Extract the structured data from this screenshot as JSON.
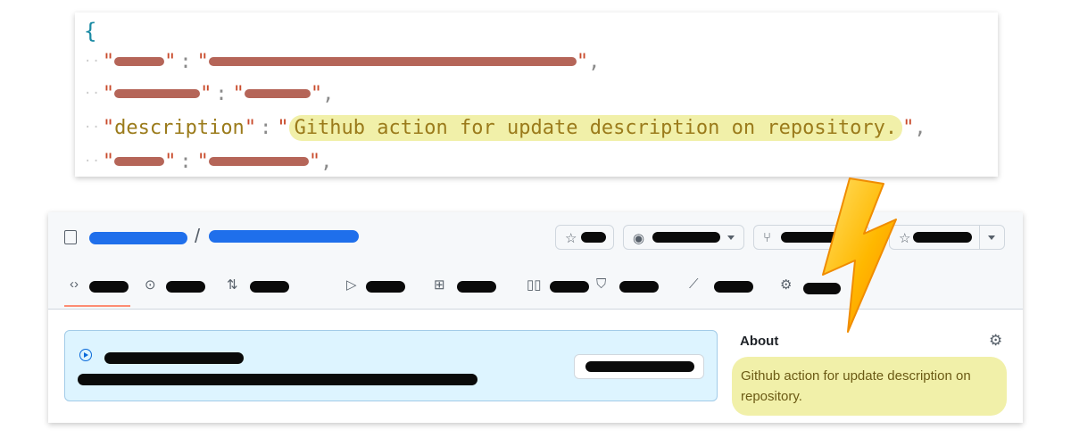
{
  "code_card": {
    "open_brace": "{",
    "dots": "··",
    "quote": "\"",
    "colon": ":",
    "comma": ",",
    "description_key": "description",
    "description_value": "Github action for update description on repository."
  },
  "repo_header": {
    "separator": "/"
  },
  "about": {
    "title": "About",
    "description": "Github action for update description on repository."
  },
  "icons": {
    "repo": "repo-icon",
    "pin": "pin-icon",
    "eye": "eye-icon",
    "fork": "fork-icon",
    "star": "star-icon",
    "code": "code-icon",
    "issues": "issues-icon",
    "pull_requests": "pull-request-icon",
    "actions": "play-icon",
    "projects": "table-icon",
    "wiki": "book-icon",
    "security": "shield-icon",
    "insights": "graph-icon",
    "settings": "gear-icon",
    "lightning": "lightning-bolt-icon"
  },
  "colors": {
    "highlight": "#f1f0a9",
    "redaction_red": "#b56558",
    "redaction_black": "#0a0a0a",
    "link_blue": "#1f6feb",
    "active_tab_underline": "#fd8c73",
    "banner_bg": "#ddf4ff"
  }
}
